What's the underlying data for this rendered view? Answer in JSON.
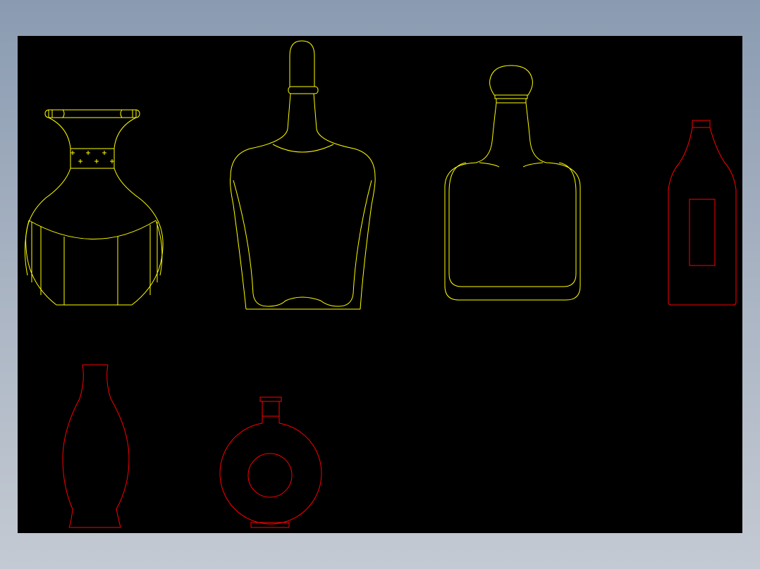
{
  "drawing": {
    "background": "#000000",
    "viewport_colors": {
      "primary_lines": "#ffff00",
      "secondary_lines": "#ff0000"
    },
    "objects": [
      {
        "name": "vase",
        "line_color": "#ffff00"
      },
      {
        "name": "whisky-bottle",
        "line_color": "#ffff00"
      },
      {
        "name": "square-decanter",
        "line_color": "#ffff00"
      },
      {
        "name": "wine-bottle",
        "line_color": "#ff0000"
      },
      {
        "name": "slim-vase",
        "line_color": "#ff0000"
      },
      {
        "name": "round-flask",
        "line_color": "#ff0000"
      }
    ]
  }
}
